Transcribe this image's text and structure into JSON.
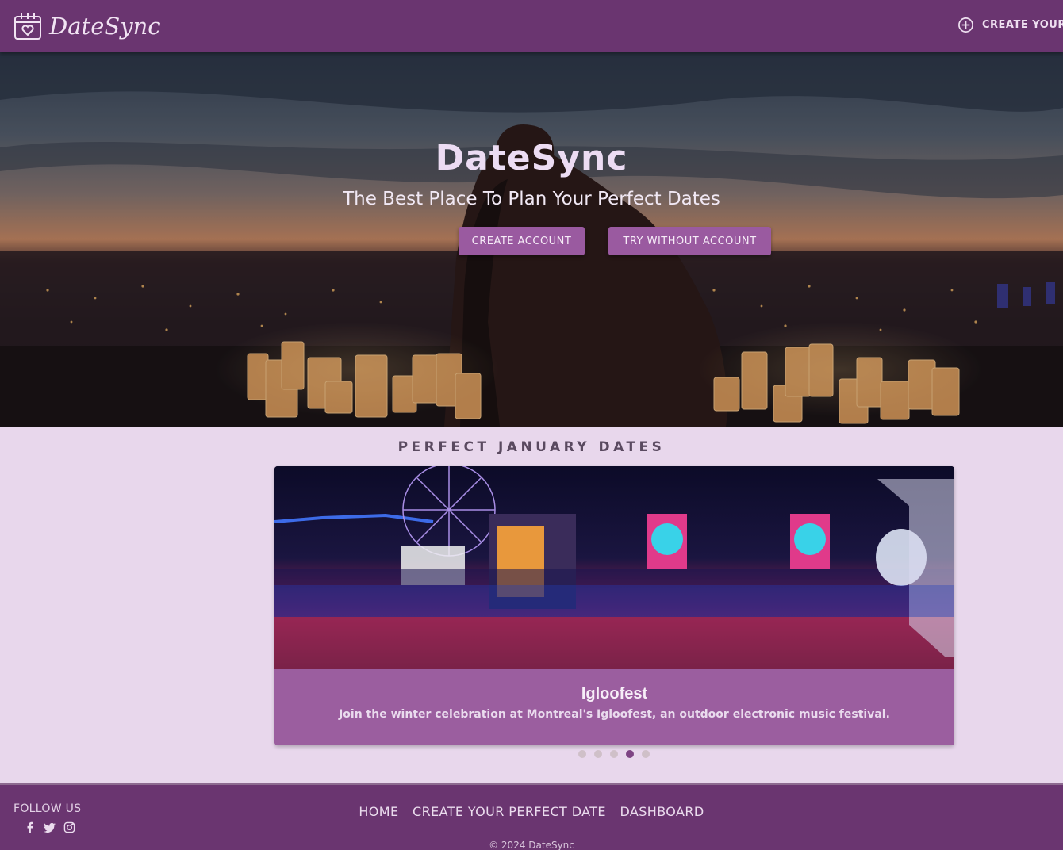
{
  "nav": {
    "brand": "DateSync",
    "create_label": "CREATE YOUR P"
  },
  "hero": {
    "title": "DateSync",
    "subtitle": "The Best Place To Plan Your Perfect Dates",
    "create_account": "CREATE ACCOUNT",
    "try_without": "TRY WITHOUT ACCOUNT"
  },
  "carousel": {
    "section_title": "PERFECT JANUARY DATES",
    "active_slide": {
      "title": "Igloofest",
      "description": "Join the winter celebration at Montreal's Igloofest, an outdoor electronic music festival."
    },
    "slide_count": 5,
    "active_index": 3
  },
  "footer": {
    "follow_us": "FOLLOW US",
    "links": {
      "home": "HOME",
      "create": "CREATE YOUR PERFECT DATE",
      "dashboard": "DASHBOARD"
    },
    "copyright": "© 2024 DateSync"
  },
  "icons": {
    "brand": "calendar-heart-icon",
    "create": "plus-circle-icon",
    "social": [
      "facebook-icon",
      "twitter-icon",
      "instagram-icon"
    ]
  },
  "colors": {
    "nav_bg": "#6a3570",
    "accent": "#9a5aa0",
    "page_bg": "#e8d7ec",
    "card_body": "#9b5e9f",
    "dot_active": "#7e4484"
  }
}
